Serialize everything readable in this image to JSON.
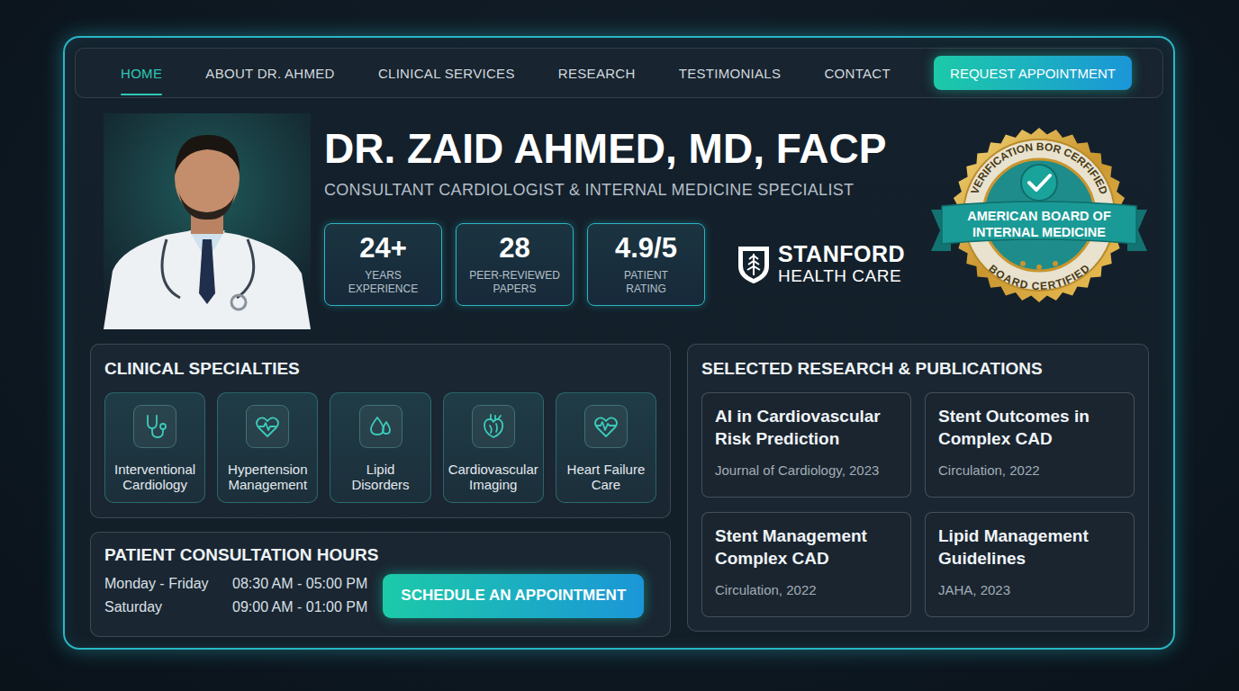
{
  "nav": {
    "items": [
      {
        "label": "HOME",
        "selected": true
      },
      {
        "label": "ABOUT DR. AHMED",
        "selected": false
      },
      {
        "label": "CLINICAL SERVICES",
        "selected": false
      },
      {
        "label": "RESEARCH",
        "selected": false
      },
      {
        "label": "TESTIMONIALS",
        "selected": false
      },
      {
        "label": "CONTACT",
        "selected": false
      }
    ],
    "cta": "REQUEST APPOINTMENT"
  },
  "profile": {
    "name": "DR. ZAID AHMED, MD, FACP",
    "title": "CONSULTANT CARDIOLOGIST & INTERNAL MEDICINE SPECIALIST"
  },
  "stats": [
    {
      "value": "24+",
      "label_lines": [
        "YEARS",
        "EXPERIENCE"
      ]
    },
    {
      "value": "28",
      "label_lines": [
        "PEER-REVIEWED",
        "PAPERS"
      ]
    },
    {
      "value": "4.9/5",
      "label_lines": [
        "PATIENT",
        "RATING"
      ]
    }
  ],
  "affiliation": {
    "line1": "STANFORD",
    "line2": "HEALTH CARE"
  },
  "badge": {
    "top": "VERIFICATION BOR CERFIFIED",
    "ribbon_lines": [
      "AMERICAN BOARD OF",
      "INTERNAL MEDICINE"
    ],
    "bottom": "BOARD CERTIFIED"
  },
  "specialties": {
    "title": "CLINICAL SPECIALTIES",
    "items": [
      {
        "label_lines": [
          "Interventional",
          "Cardiology"
        ],
        "kind": "stethoscope"
      },
      {
        "label_lines": [
          "Hypertension",
          "Management"
        ],
        "kind": "pulse"
      },
      {
        "label_lines": [
          "Lipid",
          "Disorders"
        ],
        "kind": "drops"
      },
      {
        "label_lines": [
          "Cardiovascular",
          "Imaging"
        ],
        "kind": "heart"
      },
      {
        "label_lines": [
          "Heart Failure",
          "Care"
        ],
        "kind": "ecg"
      }
    ]
  },
  "hours": {
    "title": "PATIENT CONSULTATION HOURS",
    "rows": [
      {
        "days": "Monday - Friday",
        "time": "08:30 AM - 05:00 PM"
      },
      {
        "days": "Saturday",
        "time": "09:00 AM - 01:00 PM"
      }
    ],
    "button": "SCHEDULE AN APPOINTMENT"
  },
  "research": {
    "title": "SELECTED RESEARCH & PUBLICATIONS",
    "items": [
      {
        "title_lines": [
          "AI in Cardiovascular",
          "Risk Prediction"
        ],
        "source": "Journal of Cardiology, 2023"
      },
      {
        "title_lines": [
          "Stent Outcomes in",
          "Complex CAD"
        ],
        "source": "Circulation, 2022"
      },
      {
        "title_lines": [
          "Stent Management",
          "Complex CAD"
        ],
        "source": "Circulation, 2022"
      },
      {
        "title_lines": [
          "Lipid Management",
          "Guidelines"
        ],
        "source": "JAHA, 2023"
      }
    ]
  }
}
